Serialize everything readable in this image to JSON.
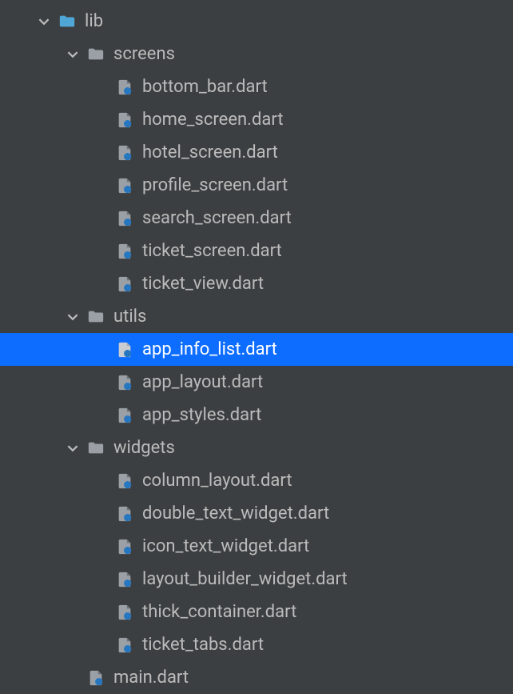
{
  "tree": {
    "lib": {
      "label": "lib",
      "screens": {
        "label": "screens",
        "files": [
          "bottom_bar.dart",
          "home_screen.dart",
          "hotel_screen.dart",
          "profile_screen.dart",
          "search_screen.dart",
          "ticket_screen.dart",
          "ticket_view.dart"
        ]
      },
      "utils": {
        "label": "utils",
        "files": [
          "app_info_list.dart",
          "app_layout.dart",
          "app_styles.dart"
        ]
      },
      "widgets": {
        "label": "widgets",
        "files": [
          "column_layout.dart",
          "double_text_widget.dart",
          "icon_text_widget.dart",
          "layout_builder_widget.dart",
          "thick_container.dart",
          "ticket_tabs.dart"
        ]
      },
      "main": "main.dart"
    }
  },
  "selected": "app_info_list.dart",
  "colors": {
    "background": "#3c3f41",
    "text": "#bbbbbb",
    "selection": "#0d6dff",
    "folderGrey": "#9aa0a6",
    "folderBlue": "#4fa7d6",
    "dartIcon": "#9aa0a6",
    "dartDot": "#2676c0"
  }
}
